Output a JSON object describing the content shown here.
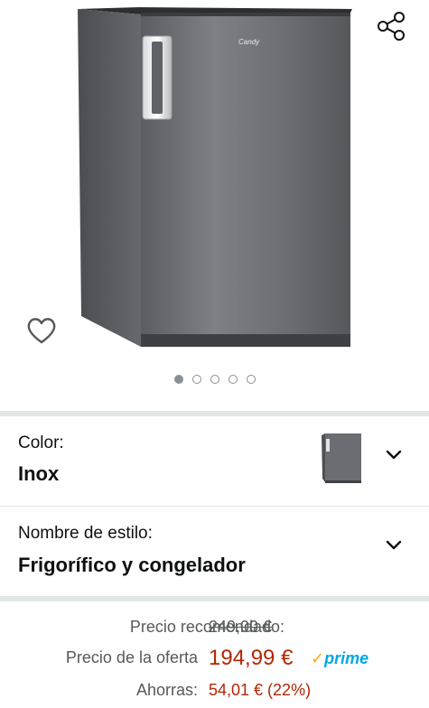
{
  "icons": {
    "share": "share-icon",
    "wishlist": "heart-outline-icon",
    "chevron": "chevron-down-icon"
  },
  "image": {
    "brand_text": "Candy",
    "dots": 5,
    "active_dot": 1
  },
  "color_section": {
    "label": "Color:",
    "value": "Inox"
  },
  "style_section": {
    "label": "Nombre de estilo:",
    "value": "Frigorífico y congelador"
  },
  "pricing": {
    "list_label": "Precio recomendado:",
    "list_price": "249,00 €",
    "deal_label": "Precio de la oferta",
    "deal_price": "194,99 €",
    "prime_check": "✓",
    "prime_word": "prime",
    "savings_label": "Ahorras:",
    "savings_value": "54,01 € (22%)"
  },
  "colors": {
    "price_red": "#b12704",
    "prime_blue": "#00a8e1",
    "prime_orange": "#ffa41c",
    "divider": "#e3e6e6"
  }
}
